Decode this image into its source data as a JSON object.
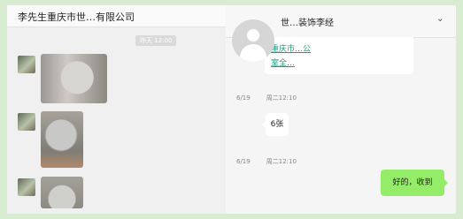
{
  "left_chat": {
    "title": "李先生重庆市世…有限公司",
    "time_pill": "昨天 12:00"
  },
  "right_chat": {
    "contact_name": "世…装饰李经",
    "link_lines": [
      "重庆市…公",
      "室全…"
    ],
    "messages": [
      {
        "date": "6/19",
        "time": "周二12:10",
        "text": "6张",
        "direction": "in"
      },
      {
        "date": "6/19",
        "time": "周二12:10",
        "text": "好的，收到",
        "direction": "out"
      }
    ],
    "top_timeline": {
      "date": "6/19",
      "time": "周二12:10"
    }
  },
  "colors": {
    "background": "#d8ecd2",
    "outgoing_bubble": "#95ec69",
    "link": "#1e9e80"
  }
}
